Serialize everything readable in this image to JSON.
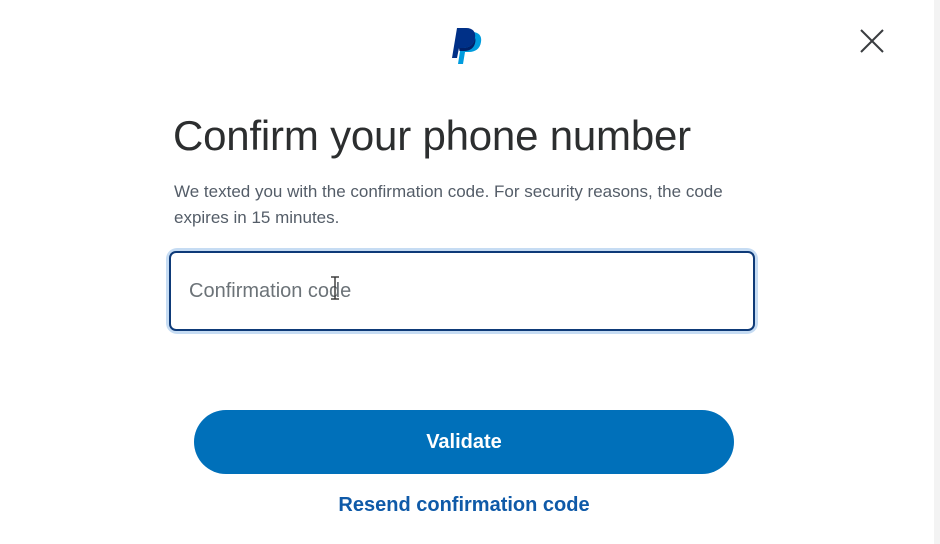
{
  "header": {
    "logo_icon": "paypal-logo-icon",
    "close_icon": "close-icon"
  },
  "main": {
    "title": "Confirm your phone number",
    "subtitle": "We texted you with the confirmation code. For security reasons, the code expires in 15 minutes.",
    "code_input": {
      "value": "",
      "placeholder": "Confirmation code"
    },
    "validate_label": "Validate",
    "resend_label": "Resend confirmation code"
  },
  "colors": {
    "primary": "#0070ba",
    "brand_dark": "#003087",
    "brand_light": "#009cde",
    "link": "#0f5aa8",
    "title_text": "#2c2e2f",
    "body_text": "#545d68"
  }
}
